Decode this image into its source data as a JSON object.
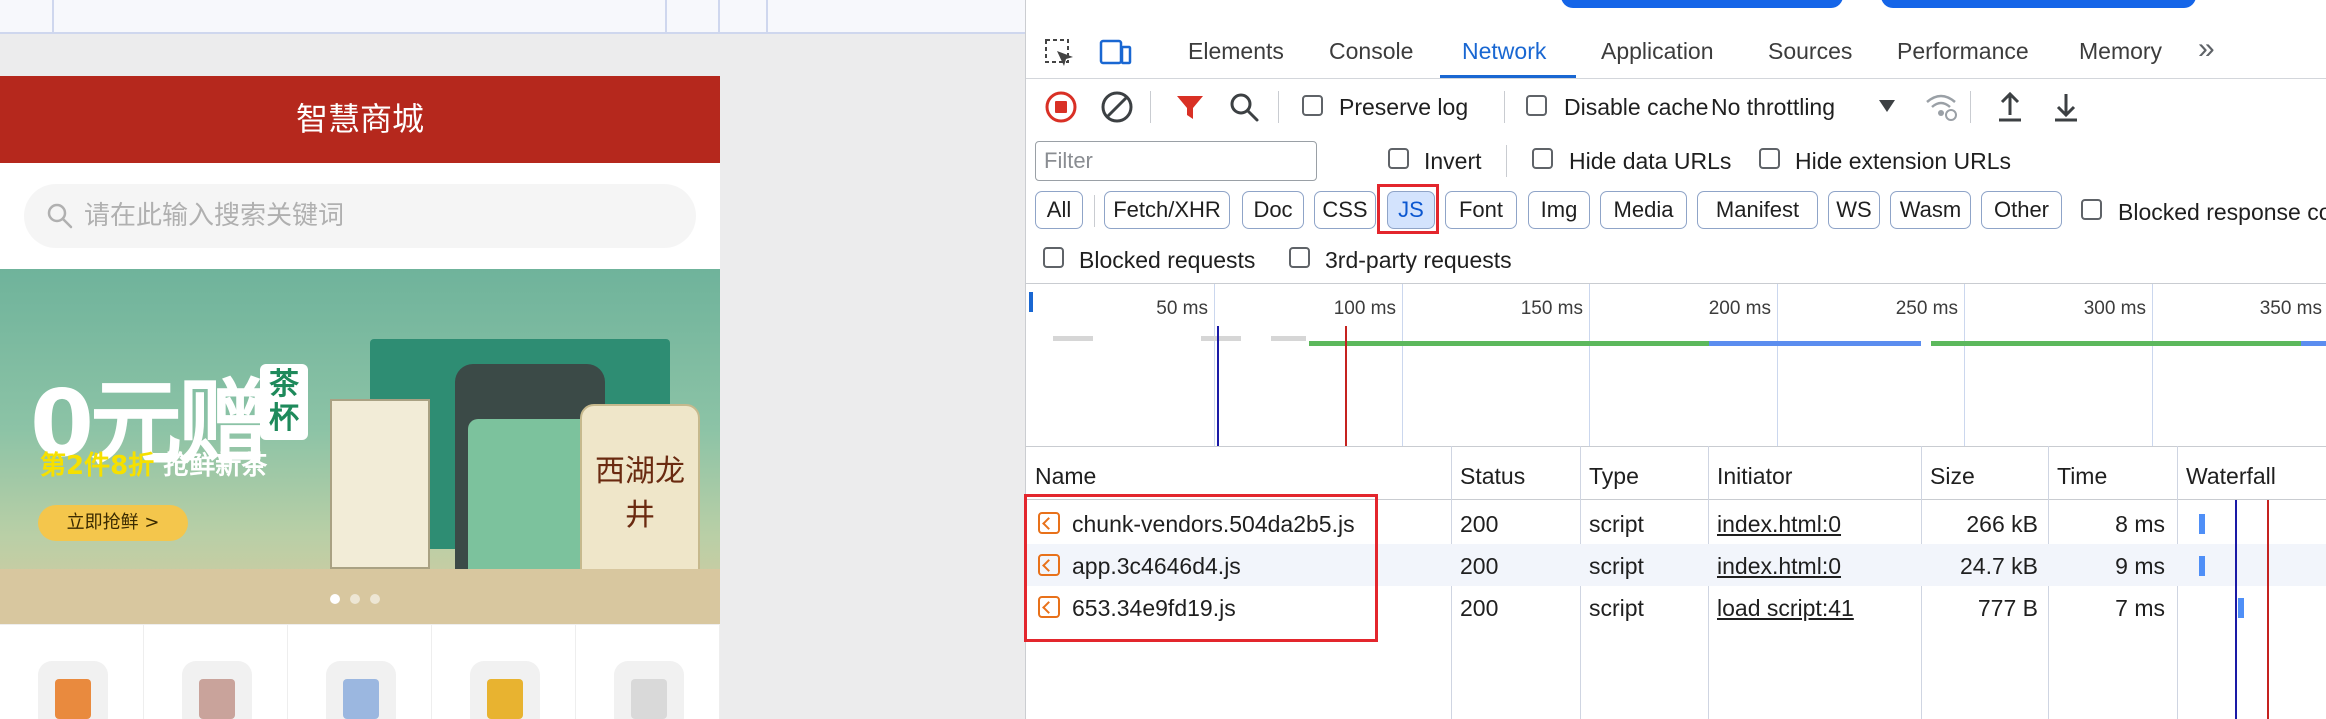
{
  "page": {
    "app_title": "智慧商城",
    "search_placeholder": "请在此输入搜索关键词",
    "banner": {
      "headline": "0元赠",
      "tag": "茶杯",
      "subline_a": "第2件8折",
      "subline_b": "抢鲜新茶",
      "button": "立即抢鲜 >",
      "bag_text": "西湖龙井",
      "active_slide": 1,
      "slide_count": 3
    },
    "categories": [
      {
        "icon": "bag-icon",
        "color": "#e98a3e"
      },
      {
        "icon": "bedding-icon",
        "color": "#c9a39b"
      },
      {
        "icon": "shirt-icon",
        "color": "#9bb7e0"
      },
      {
        "icon": "noodle-icon",
        "color": "#e8b330"
      },
      {
        "icon": "tissue-icon",
        "color": "#d9d9d9"
      }
    ]
  },
  "devtools": {
    "tabs": [
      "Elements",
      "Console",
      "Network",
      "Application",
      "Sources",
      "Performance",
      "Memory"
    ],
    "active_tab": "Network",
    "more_tabs": "»",
    "toolbar": {
      "preserve_log": "Preserve log",
      "disable_cache": "Disable cache",
      "throttling": "No throttling"
    },
    "filter": {
      "placeholder": "Filter",
      "invert": "Invert",
      "hide_data_urls": "Hide data URLs",
      "hide_extension_urls": "Hide extension URLs"
    },
    "type_filters": [
      "All",
      "Fetch/XHR",
      "Doc",
      "CSS",
      "JS",
      "Font",
      "Img",
      "Media",
      "Manifest",
      "WS",
      "Wasm",
      "Other"
    ],
    "active_type": "JS",
    "blocked_response_cookies": "Blocked response coo",
    "blocked_requests": "Blocked requests",
    "third_party_requests": "3rd-party requests",
    "overview_ticks": [
      "50 ms",
      "100 ms",
      "150 ms",
      "200 ms",
      "250 ms",
      "300 ms",
      "350 ms"
    ],
    "columns": [
      "Name",
      "Status",
      "Type",
      "Initiator",
      "Size",
      "Time",
      "Waterfall"
    ],
    "requests": [
      {
        "name": "chunk-vendors.504da2b5.js",
        "status": "200",
        "type": "script",
        "initiator": "index.html:0",
        "size": "266 kB",
        "time": "8 ms"
      },
      {
        "name": "app.3c4646d4.js",
        "status": "200",
        "type": "script",
        "initiator": "index.html:0",
        "size": "24.7 kB",
        "time": "9 ms"
      },
      {
        "name": "653.34e9fd19.js",
        "status": "200",
        "type": "script",
        "initiator": "load script:41",
        "size": "777 B",
        "time": "7 ms"
      }
    ],
    "colors": {
      "accent": "#1967d2",
      "highlight_box": "#e3262d",
      "record_red": "#d93025",
      "dom_loaded_line": "#1a1aa6",
      "load_line": "#c5221f"
    }
  }
}
